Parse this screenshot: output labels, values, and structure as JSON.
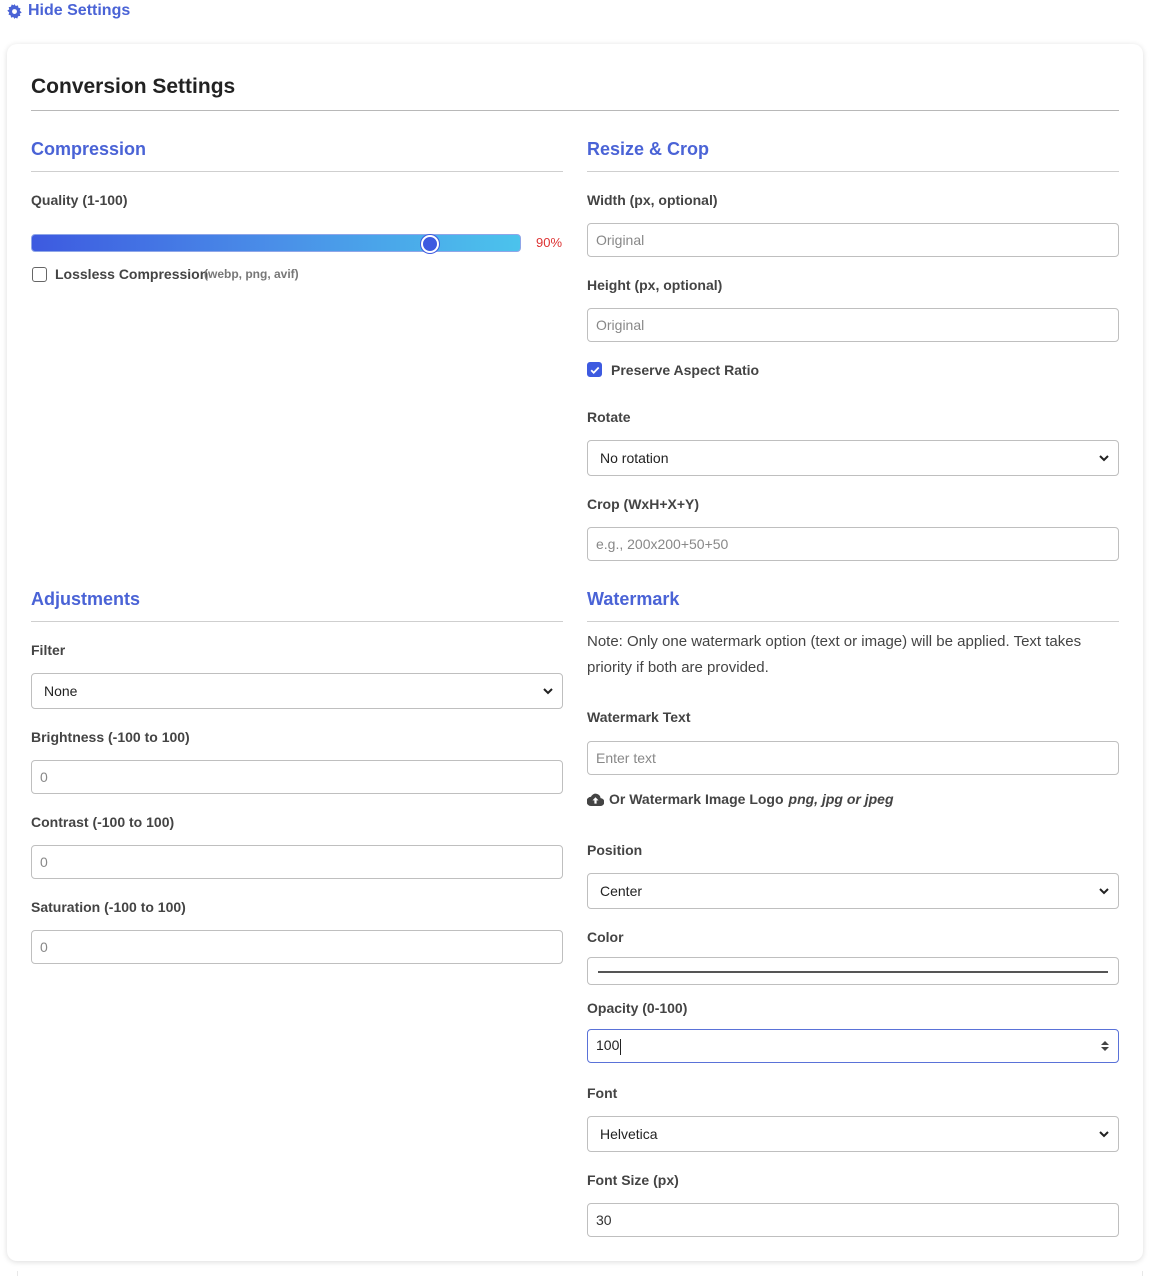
{
  "toggle": {
    "label": "Hide Settings",
    "icon": "gear-icon"
  },
  "card": {
    "title": "Conversion Settings"
  },
  "colors": {
    "accent": "#4a63d6",
    "slider_value": "#dd3333"
  },
  "compression": {
    "heading": "Compression",
    "quality_label": "Quality (1-100)",
    "quality_value": 90,
    "quality_display": "90%",
    "lossless_label": "Lossless Compression",
    "lossless_hint": "(webp, png, avif)",
    "lossless_checked": false
  },
  "resize": {
    "heading": "Resize & Crop",
    "width_label": "Width (px, optional)",
    "width_placeholder": "Original",
    "height_label": "Height (px, optional)",
    "height_placeholder": "Original",
    "aspect_label": "Preserve Aspect Ratio",
    "aspect_checked": true,
    "rotate_label": "Rotate",
    "rotate_value": "No rotation",
    "crop_label": "Crop (WxH+X+Y)",
    "crop_placeholder": "e.g., 200x200+50+50"
  },
  "adjustments": {
    "heading": "Adjustments",
    "filter_label": "Filter",
    "filter_value": "None",
    "brightness_label": "Brightness (-100 to 100)",
    "brightness_placeholder": "0",
    "contrast_label": "Contrast (-100 to 100)",
    "contrast_placeholder": "0",
    "saturation_label": "Saturation (-100 to 100)",
    "saturation_placeholder": "0"
  },
  "watermark": {
    "heading": "Watermark",
    "note": "Note: Only one watermark option (text or image) will be applied. Text takes priority if both are provided.",
    "text_label": "Watermark Text",
    "text_placeholder": "Enter text",
    "upload_label": "Or Watermark Image Logo",
    "upload_formats": "png, jpg or jpeg",
    "position_label": "Position",
    "position_value": "Center",
    "color_label": "Color",
    "opacity_label": "Opacity (0-100)",
    "opacity_value": "100",
    "font_label": "Font",
    "font_value": "Helvetica",
    "font_size_label": "Font Size (px)",
    "font_size_value": "30"
  }
}
